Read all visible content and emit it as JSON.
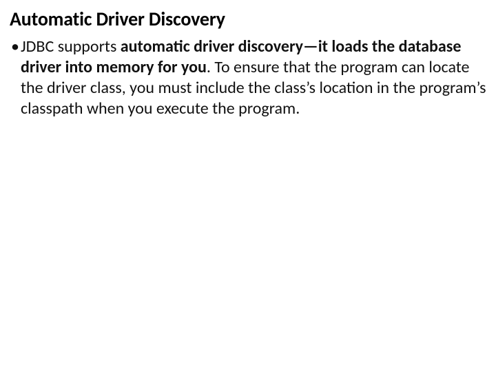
{
  "slide": {
    "title": "Automatic Driver Discovery",
    "bullet": {
      "lead": "JDBC supports ",
      "bold": "automatic driver discovery—it loads the database driver into memory for you",
      "tail": ". To ensure that the program can locate the driver class, you must include the class’s location in the program’s classpath when you execute the program."
    }
  }
}
